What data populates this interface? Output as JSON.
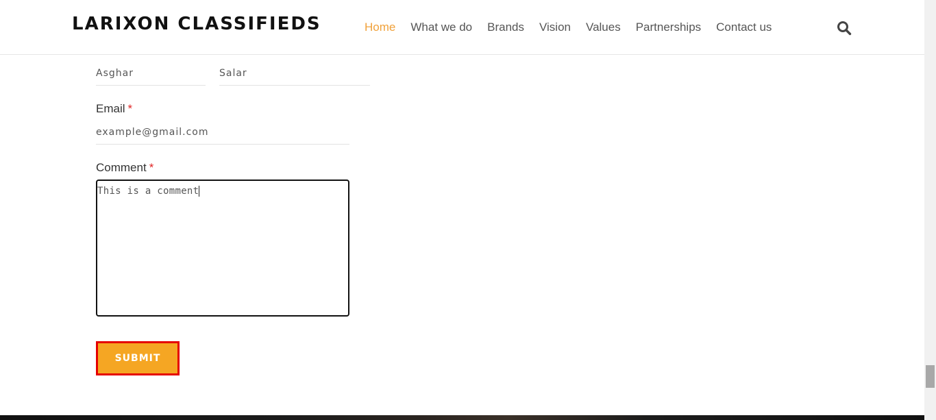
{
  "header": {
    "logo": "LARIXON CLASSIFIEDS",
    "nav": [
      "Home",
      "What we do",
      "Brands",
      "Vision",
      "Values",
      "Partnerships",
      "Contact us"
    ],
    "active_nav": "Home",
    "search_icon": "search-icon"
  },
  "form": {
    "first_name_value": "Asghar",
    "last_name_value": "Salar",
    "email_label": "Email",
    "email_value": "example@gmail.com",
    "comment_label": "Comment",
    "comment_value": "This is a comment",
    "required_mark": "*",
    "submit_label": "SUBMIT"
  },
  "colors": {
    "accent": "#f5a623",
    "active_nav": "#f0a13a",
    "required": "#e02525",
    "submit_highlight_border": "#e50000"
  }
}
